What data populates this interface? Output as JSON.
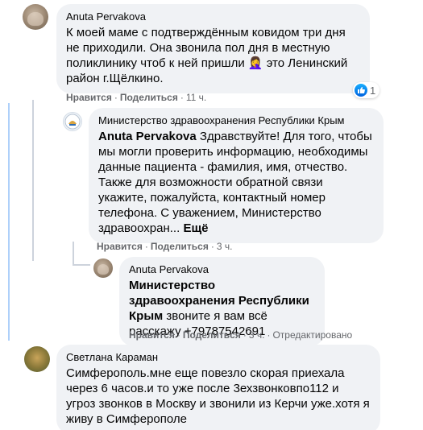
{
  "comments": [
    {
      "author": "Anuta Pervakova",
      "text": "К моей маме с подтверждённым ковидом три дня не приходили. Она звонила пол дня в местную поликлинику чтоб к ней пришли 🤦‍♀️ это Ленинский район г.Щёлкино.",
      "reaction_count": "1",
      "actions": {
        "like": "Нравится",
        "share": "Поделиться",
        "time": "11 ч."
      }
    },
    {
      "author": "Министерство здравоохранения Республики Крым",
      "mention": "Anuta Pervakova",
      "text": "Здравствуйте! Для того, чтобы мы могли проверить информацию, необходимы данные пациента - фамилия, имя, отчество. Также для возможности обратной связи укажите, пожалуйста, контактный номер телефона. С уважением, Министерство здравоохран...",
      "more": "Ещё",
      "actions": {
        "like": "Нравится",
        "share": "Поделиться",
        "time": "3 ч."
      }
    },
    {
      "author": "Anuta Pervakova",
      "mention": "Министерство здравоохранения Республики Крым",
      "text": "звоните я вам всё расскажу +79787542691",
      "actions": {
        "like": "Нравится",
        "share": "Поделиться",
        "time": "3 ч.",
        "edited": "Отредактировано"
      }
    },
    {
      "author": "Светлана Караман",
      "text": "Симферополь.мне еще повезло скорая приехала через 6 часов.и то уже после 3ехзвонковпо112 и угроз звонков в Москву и звонили из Керчи уже.хотя я живу в Симферополе"
    }
  ],
  "separator": "·",
  "icons": [
    "like-icon",
    "ministry-emblem-icon"
  ],
  "colors": {
    "bubble": "#f0f2f5",
    "meta": "#65676b",
    "like_blue": "#1877f2",
    "thread_line": "#cdd3dc"
  }
}
